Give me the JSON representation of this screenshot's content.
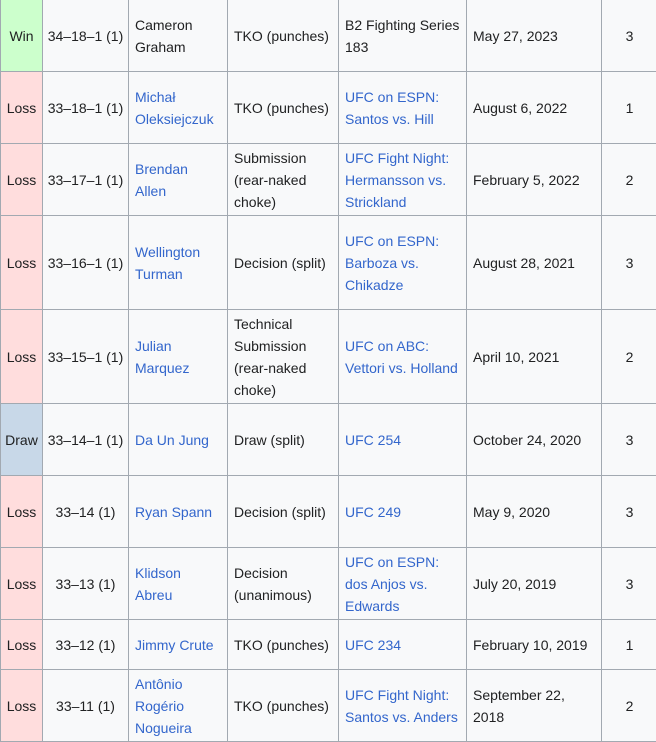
{
  "rows": [
    {
      "result": "Win",
      "record": "34–18–1 (1)",
      "opponent": "Cameron Graham",
      "opponent_link": false,
      "method": "TKO (punches)",
      "event": "B2 Fighting Series 183",
      "event_link": false,
      "date": "May 27, 2023",
      "round": "3"
    },
    {
      "result": "Loss",
      "record": "33–18–1 (1)",
      "opponent": "Michał Oleksiejczuk",
      "opponent_link": true,
      "method": "TKO (punches)",
      "event": "UFC on ESPN: Santos vs. Hill",
      "event_link": true,
      "date": "August 6, 2022",
      "round": "1"
    },
    {
      "result": "Loss",
      "record": "33–17–1 (1)",
      "opponent": "Brendan Allen",
      "opponent_link": true,
      "method": "Submission (rear-naked choke)",
      "event": "UFC Fight Night: Hermansson vs. Strickland",
      "event_link": true,
      "date": "February 5, 2022",
      "round": "2"
    },
    {
      "result": "Loss",
      "record": "33–16–1 (1)",
      "opponent": "Wellington Turman",
      "opponent_link": true,
      "method": "Decision (split)",
      "event": "UFC on ESPN: Barboza vs. Chikadze",
      "event_link": true,
      "date": "August 28, 2021",
      "round": "3"
    },
    {
      "result": "Loss",
      "record": "33–15–1 (1)",
      "opponent": "Julian Marquez",
      "opponent_link": true,
      "method": "Technical Submission (rear-naked choke)",
      "event": "UFC on ABC: Vettori vs. Holland",
      "event_link": true,
      "date": "April 10, 2021",
      "round": "2"
    },
    {
      "result": "Draw",
      "record": "33–14–1 (1)",
      "opponent": "Da Un Jung",
      "opponent_link": true,
      "method": "Draw (split)",
      "event": "UFC 254",
      "event_link": true,
      "date": "October 24, 2020",
      "round": "3"
    },
    {
      "result": "Loss",
      "record": "33–14 (1)",
      "opponent": "Ryan Spann",
      "opponent_link": true,
      "method": "Decision (split)",
      "event": "UFC 249",
      "event_link": true,
      "date": "May 9, 2020",
      "round": "3"
    },
    {
      "result": "Loss",
      "record": "33–13 (1)",
      "opponent": "Klidson Abreu",
      "opponent_link": true,
      "method": "Decision (unanimous)",
      "event": "UFC on ESPN: dos Anjos vs. Edwards",
      "event_link": true,
      "date": "July 20, 2019",
      "round": "3"
    },
    {
      "result": "Loss",
      "record": "33–12 (1)",
      "opponent": "Jimmy Crute",
      "opponent_link": true,
      "method": "TKO (punches)",
      "event": "UFC 234",
      "event_link": true,
      "date": "February 10, 2019",
      "round": "1"
    },
    {
      "result": "Loss",
      "record": "33–11 (1)",
      "opponent": "Antônio Rogério Nogueira",
      "opponent_link": true,
      "method": "TKO (punches)",
      "event": "UFC Fight Night: Santos vs. Anders",
      "event_link": true,
      "date": "September 22, 2018",
      "round": "2"
    }
  ],
  "colors": {
    "win": "#ccffcc",
    "loss": "#ffdddd",
    "draw": "#c8d8e8",
    "link": "#3366cc"
  }
}
